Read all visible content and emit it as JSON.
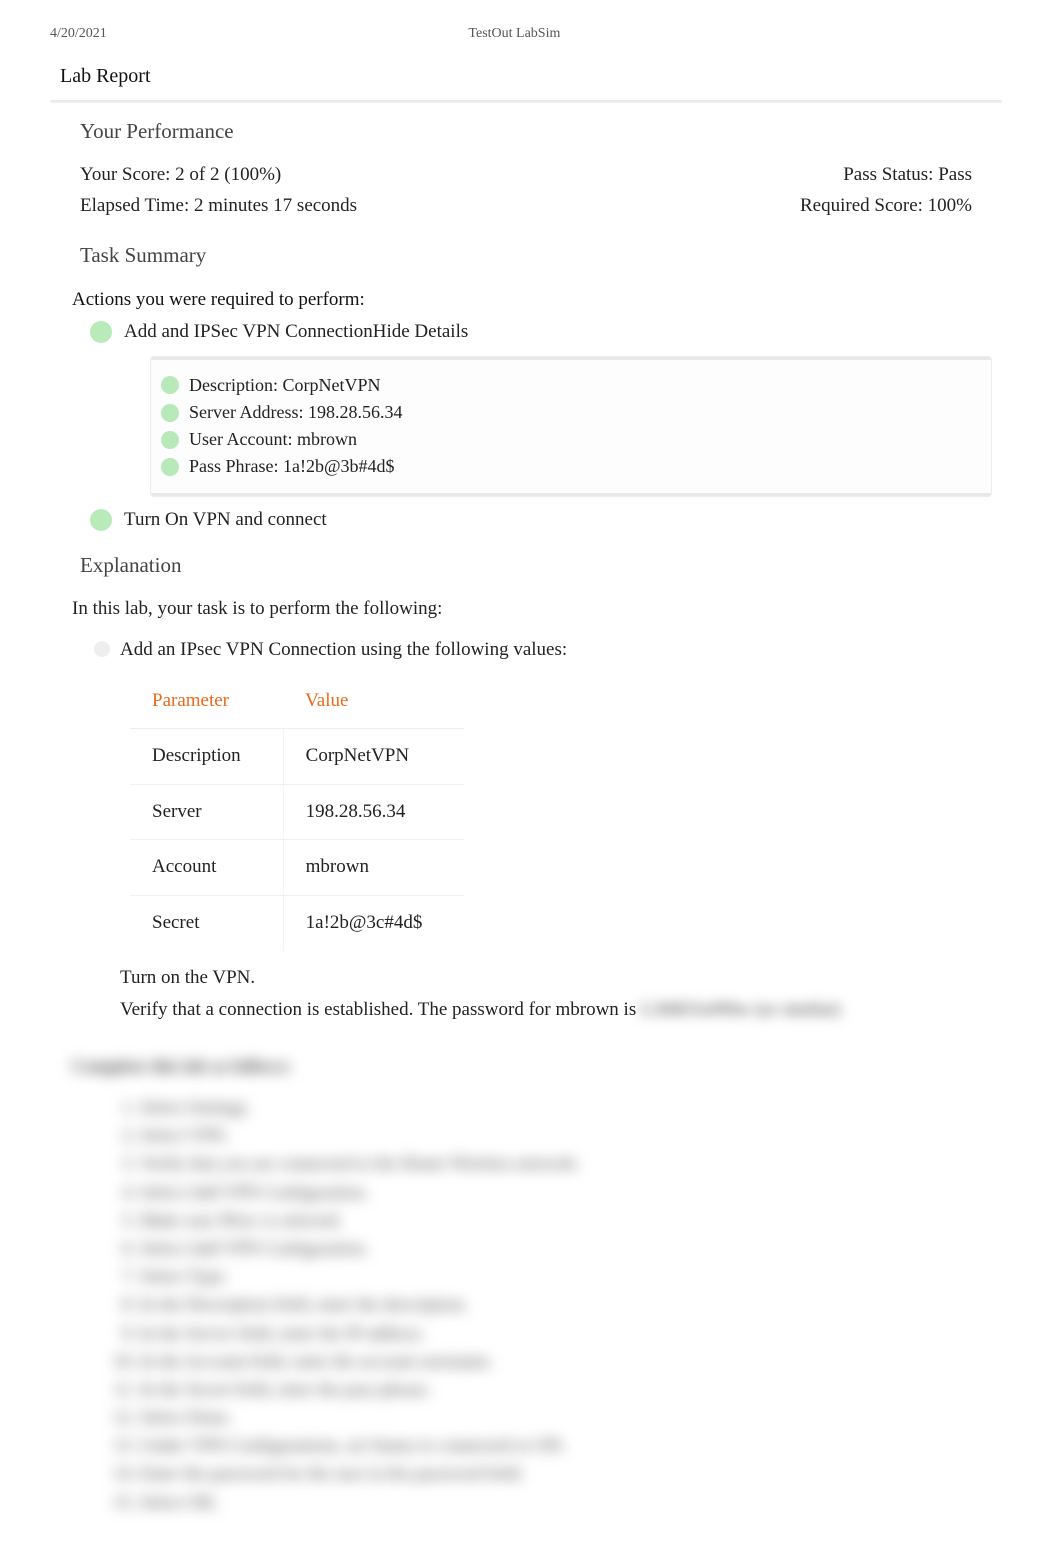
{
  "header": {
    "date": "4/20/2021",
    "title": "TestOut LabSim"
  },
  "report_title": "Lab Report",
  "performance": {
    "section": "Your Performance",
    "score_label": "Your Score: 2 of 2 (100%)",
    "pass_label": "Pass Status: Pass",
    "elapsed_label": "Elapsed Time: 2 minutes 17 seconds",
    "required_label": "Required Score: 100%"
  },
  "task_summary": {
    "section": "Task Summary",
    "subheading": "Actions you were required to perform:",
    "actions": [
      {
        "label": "Add and IPSec VPN Connection",
        "toggle": "Hide Details",
        "details": [
          "Description: CorpNetVPN",
          "Server Address: 198.28.56.34",
          "User Account: mbrown",
          "Pass Phrase: 1a!2b@3b#4d$"
        ]
      },
      {
        "label": "Turn On VPN and connect"
      }
    ]
  },
  "explanation": {
    "section": "Explanation",
    "intro": "In this lab, your task is to perform the following:",
    "items": [
      "Add an IPsec VPN Connection using the following values:"
    ],
    "table": {
      "headers": [
        "Parameter",
        "Value"
      ],
      "rows": [
        [
          "Description",
          "CorpNetVPN"
        ],
        [
          "Server",
          "198.28.56.34"
        ],
        [
          "Account",
          "mbrown"
        ],
        [
          "Secret",
          "1a!2b@3c#4d$"
        ]
      ]
    },
    "followups": [
      "Turn on the VPN.",
      "Verify that a connection is established. The password for mbrown is"
    ],
    "blurred_password": "L3tM31nN0w (or similar)"
  },
  "blurred_steps": {
    "heading": "Complete this lab as follows:",
    "steps": [
      "Select Settings.",
      "Select VPN.",
      "Verify that you are connected to the Home Wireless network.",
      "Select Add VPN Configuration.",
      "Make sure IPsec is selected.",
      "Select Add VPN Configuration.",
      "Select Type.",
      "In the Description field, enter the description.",
      "In the Server field, enter the IP address.",
      "In the Account field, enter the account username.",
      "In the Secret field, enter the pass phrase.",
      "Select Done.",
      "Under VPN Configurations, set Status to connected or ON.",
      "Enter the password for the user in the password field.",
      "Select OK."
    ]
  }
}
